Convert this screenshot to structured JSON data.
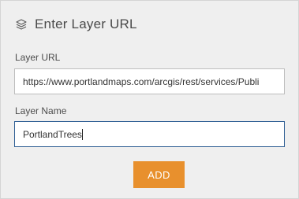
{
  "dialog": {
    "title": "Enter Layer URL",
    "title_icon": "layers-icon"
  },
  "form": {
    "layer_url": {
      "label": "Layer URL",
      "value": "https://www.portlandmaps.com/arcgis/rest/services/Publi"
    },
    "layer_name": {
      "label": "Layer Name",
      "value": "PortlandTrees"
    },
    "add_button_label": "ADD"
  },
  "colors": {
    "accent": "#e8902d",
    "focus_border": "#2f5f94",
    "panel_bg": "#efefef"
  }
}
